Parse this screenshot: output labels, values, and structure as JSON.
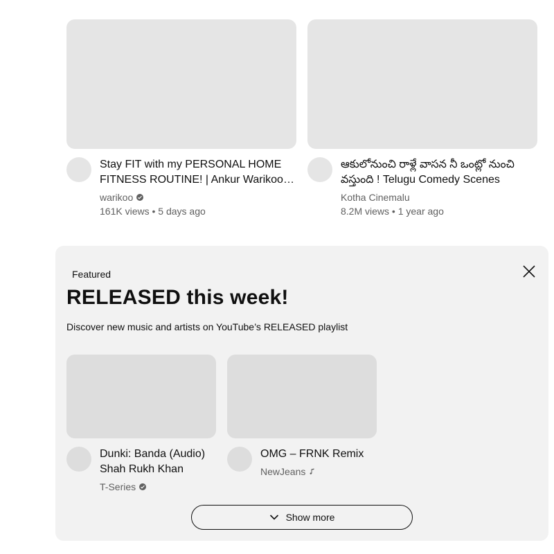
{
  "videos": [
    {
      "title": "Stay FIT with my PERSONAL HOME FITNESS ROUTINE! | Ankur Warikoo fitness routine",
      "channel": "warikoo",
      "verified": true,
      "stats": "161K views • 5 days ago"
    },
    {
      "title": "ఆకులోనుంచి రాళ్లే వాసన నీ ఒంట్లో నుంచి వస్తుంది ! Telugu Comedy Scenes",
      "channel": "Kotha Cinemalu",
      "verified": false,
      "stats": "8.2M views • 1 year ago"
    }
  ],
  "shelf": {
    "label": "Featured",
    "title": "RELEASED this week!",
    "description": "Discover new music and artists on YouTube’s RELEASED playlist",
    "close_icon": "close-icon",
    "items": [
      {
        "title": "Dunki: Banda (Audio) Shah Rukh Khan",
        "channel": "T-Series",
        "badge": "verified"
      },
      {
        "title": "OMG – FRNK Remix",
        "channel": "NewJeans",
        "badge": "music-note"
      }
    ],
    "show_more_label": "Show more",
    "show_more_icon": "chevron-down-icon"
  },
  "colors": {
    "placeholder": "#e5e5e5",
    "shelf_bg": "#f2f2f2",
    "secondary_text": "#606060"
  }
}
